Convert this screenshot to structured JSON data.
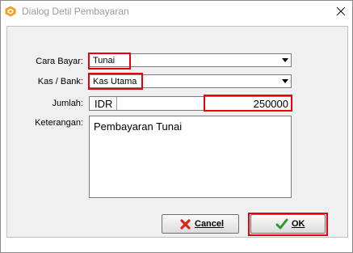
{
  "window": {
    "title": "Dialog Detil Pembayaran"
  },
  "form": {
    "cara_bayar_label": "Cara Bayar:",
    "cara_bayar_value": "Tunai",
    "kas_bank_label": "Kas / Bank:",
    "kas_bank_value": "Kas Utama",
    "jumlah_label": "Jumlah:",
    "currency": "IDR",
    "amount": "250000",
    "keterangan_label": "Keterangan:",
    "keterangan_value": "Pembayaran Tunai"
  },
  "buttons": {
    "cancel_label": "Cancel",
    "ok_label": "OK"
  },
  "colors": {
    "highlight": "#e8000b",
    "cancel_icon": "#d9261c",
    "ok_icon": "#2e9a2e",
    "app_icon": "#f0a020"
  },
  "icons": {
    "app": "app-logo-icon",
    "close": "close-icon",
    "cancel": "cross-icon",
    "ok": "checkmark-icon"
  }
}
